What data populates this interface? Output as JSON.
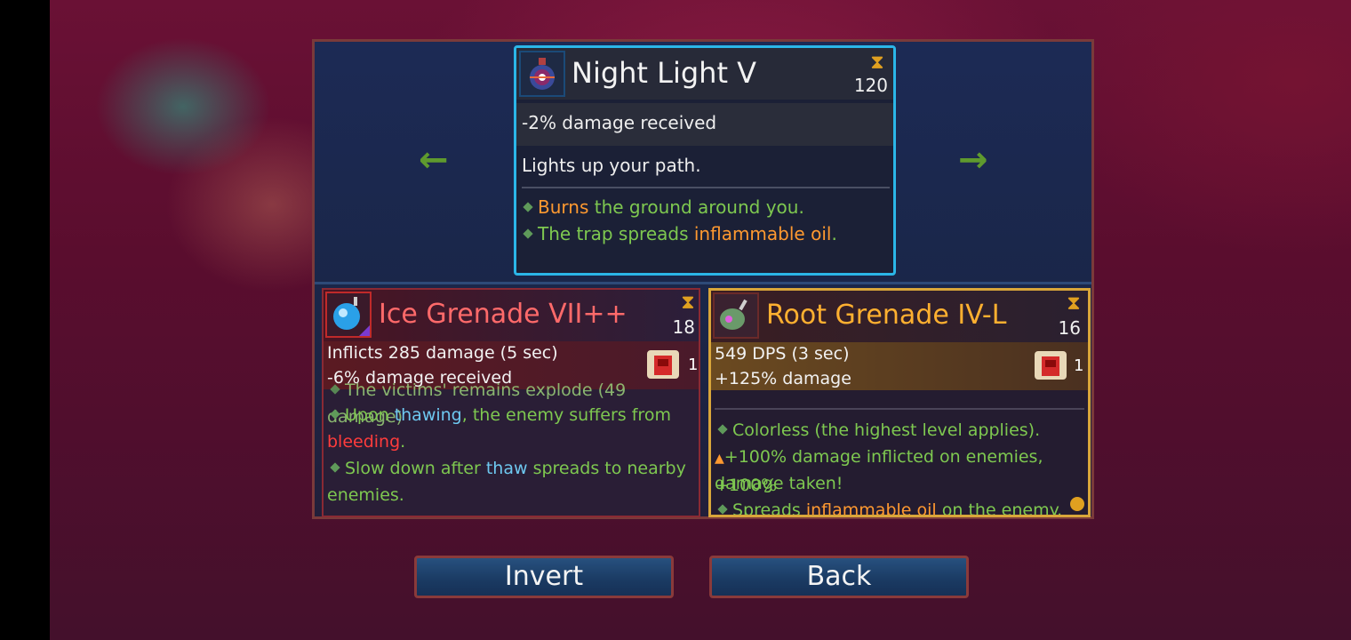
{
  "nav": {
    "prev_arrow": "←",
    "next_arrow": "→"
  },
  "top_card": {
    "title": "Night Light V",
    "hourglass": "⧗",
    "cooldown": "120",
    "stat": "-2% damage received",
    "description": "Lights up your path.",
    "bullets": [
      {
        "parts": [
          {
            "text": "Burns",
            "color": "orange"
          },
          {
            "text": " the ground around you.",
            "color": "green"
          }
        ]
      },
      {
        "parts": [
          {
            "text": "The trap spreads ",
            "color": "green"
          },
          {
            "text": "inflammable oil",
            "color": "orange"
          },
          {
            "text": ".",
            "color": "green"
          }
        ]
      }
    ]
  },
  "ice_card": {
    "title": "Ice Grenade VII++",
    "hourglass": "⧗",
    "cooldown": "18",
    "stat1": "Inflicts 285 damage (5 sec)",
    "stat2": "-6% damage received",
    "multiplier": "1",
    "line_cut": "The victims' remains explode (49 damage)",
    "line1a": "Upon ",
    "line1b": "thawing",
    "line1c": ", the enemy suffers from",
    "line2a": "bleeding",
    "line2b": ".",
    "line3a": "Slow down after ",
    "line3b": "thaw",
    "line3c": " spreads to nearby",
    "line4": "enemies."
  },
  "root_card": {
    "title": "Root Grenade IV-L",
    "hourglass": "⧗",
    "cooldown": "16",
    "stat1": "549 DPS (3 sec)",
    "stat2": "+125% damage",
    "multiplier": "1",
    "line1": "Colorless (the highest level applies).",
    "line2": "+100% damage inflicted on enemies, +100%",
    "line3": "damage taken!",
    "line4a": "Spreads ",
    "line4b": "inflammable oil",
    "line4c": " on the enemy."
  },
  "buttons": {
    "invert": "Invert",
    "back": "Back"
  },
  "colors": {
    "accent_cyan": "#2bb6e8",
    "legendary_gold": "#d9a63a",
    "text_green": "#7ec850",
    "text_orange": "#ff9930",
    "ice_red": "#ff6a6a",
    "root_gold": "#ffb030"
  }
}
